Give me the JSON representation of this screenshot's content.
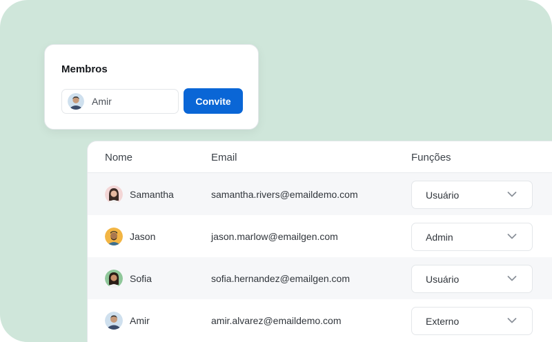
{
  "invite": {
    "title": "Membros",
    "input_value": "Amir",
    "button_label": "Convite"
  },
  "table": {
    "headers": {
      "name": "Nome",
      "email": "Email",
      "roles": "Funções"
    },
    "rows": [
      {
        "name": "Samantha",
        "email": "samantha.rivers@emaildemo.com",
        "role": "Usuário"
      },
      {
        "name": "Jason",
        "email": "jason.marlow@emailgen.com",
        "role": "Admin"
      },
      {
        "name": "Sofia",
        "email": "sofia.hernandez@emailgen.com",
        "role": "Usuário"
      },
      {
        "name": "Amir",
        "email": "amir.alvarez@emaildemo.com",
        "role": "Externo"
      }
    ]
  },
  "icons": {
    "dropdown": "chevron-down-icon",
    "avatar": "avatar-photo"
  },
  "colors": {
    "background": "#cfe6da",
    "primary_button": "#0a66d6",
    "row_alt": "#f6f7f9"
  }
}
